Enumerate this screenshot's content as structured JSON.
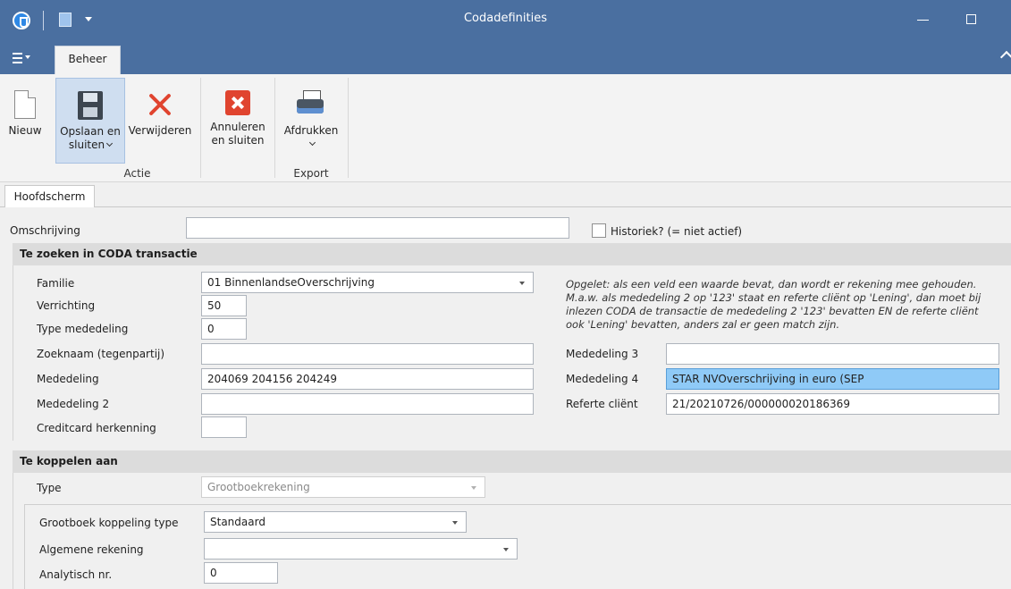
{
  "window": {
    "title": "Codadefinities"
  },
  "ribbon": {
    "tab": "Beheer",
    "buttons": {
      "new": "Nieuw",
      "save_line1": "Opslaan en",
      "save_line2": "sluiten",
      "delete": "Verwijderen",
      "cancel_line1": "Annuleren",
      "cancel_line2": "en sluiten",
      "print": "Afdrukken"
    },
    "groups": {
      "action": "Actie",
      "export": "Export"
    }
  },
  "doc_tab": "Hoofdscherm",
  "form": {
    "omschrijving_label": "Omschrijving",
    "omschrijving_value": "",
    "historiek_label": "Historiek? (= niet actief)",
    "section_search": "Te zoeken in CODA transactie",
    "familie_label": "Familie",
    "familie_value": "01   BinnenlandseOverschrijving",
    "verrichting_label": "Verrichting",
    "verrichting_value": "50",
    "type_mededeling_label": "Type mededeling",
    "type_mededeling_value": "0",
    "zoeknaam_label": "Zoeknaam (tegenpartij)",
    "zoeknaam_value": "",
    "mededeling_label": "Mededeling",
    "mededeling_value": "204069 204156 204249",
    "mededeling2_label": "Mededeling 2",
    "mededeling2_value": "",
    "creditcard_label": "Creditcard herkenning",
    "creditcard_value": "",
    "note_line1": "Opgelet: als een veld een waarde bevat, dan wordt er rekening mee gehouden.",
    "note_line2": "M.a.w. als mededeling 2 op '123' staat en referte cliënt op 'Lening', dan moet bij",
    "note_line3": "inlezen CODA de transactie de mededeling 2 '123' bevatten EN de referte cliënt",
    "note_line4": "ook 'Lening' bevatten, anders zal er geen match zijn.",
    "mededeling3_label": "Mededeling 3",
    "mededeling3_value": "",
    "mededeling4_label": "Mededeling 4",
    "mededeling4_value": "STAR NVOverschrijving in euro (SEP",
    "referte_label": "Referte cliënt",
    "referte_value": "21/20210726/000000020186369",
    "section_link": "Te koppelen aan",
    "type_label": "Type",
    "type_value": "Grootboekrekening",
    "gb_type_label": "Grootboek koppeling type",
    "gb_type_value": "Standaard",
    "alg_rek_label": "Algemene rekening",
    "alg_rek_value": "",
    "analytisch_label": "Analytisch nr.",
    "analytisch_value": "0"
  }
}
